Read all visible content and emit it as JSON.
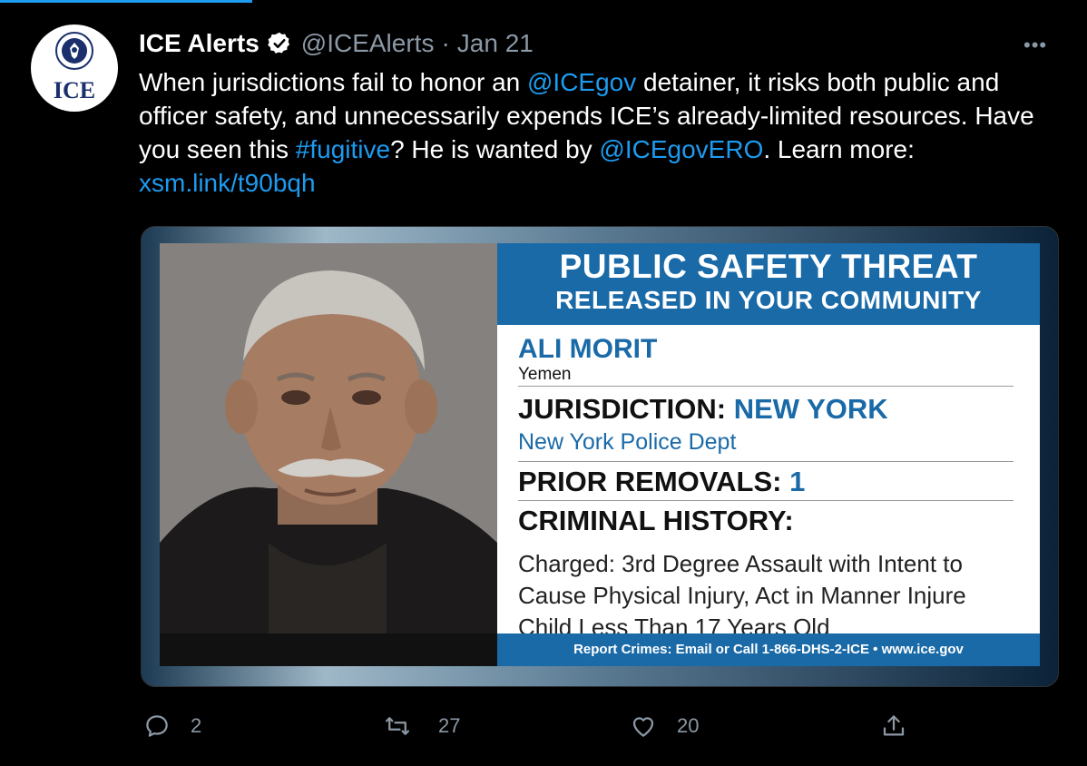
{
  "tweet": {
    "author_name": "ICE Alerts",
    "handle": "@ICEAlerts",
    "separator": "·",
    "date": "Jan 21",
    "more_label": "•••",
    "avatar_text": "ICE",
    "text_parts": {
      "p1": "When jurisdictions fail to honor an ",
      "mention1": "@ICEgov",
      "p2": " detainer, it risks both public and officer safety, and unnecessarily expends ICE’s already-limited resources. Have you seen this ",
      "hashtag": "#fugitive",
      "p3": "? He is wanted by ",
      "mention2": "@ICEgovERO",
      "p4": ". Learn more: ",
      "link": "xsm.link/t90bqh"
    }
  },
  "card": {
    "banner_title": "PUBLIC SAFETY THREAT",
    "banner_subtitle": "RELEASED IN YOUR COMMUNITY",
    "person_name": "ALI MORIT",
    "country": "Yemen",
    "jurisdiction_label": "JURISDICTION:",
    "jurisdiction_value": "NEW YORK",
    "police_dept": "New York Police Dept",
    "prior_removals_label": "PRIOR REMOVALS:",
    "prior_removals_value": "1",
    "criminal_history_label": "CRIMINAL HISTORY:",
    "charges": "Charged: 3rd Degree Assault with Intent to Cause Physical Injury, Act in Manner Injure Child Less Than 17 Years Old",
    "footer": "Report Crimes: Email or Call 1-866-DHS-2-ICE  •  www.ice.gov"
  },
  "actions": {
    "reply_count": "2",
    "retweet_count": "27",
    "like_count": "20"
  },
  "colors": {
    "link": "#1d9bf0",
    "muted": "#8b98a5",
    "card_blue": "#1a6aa8"
  },
  "icons": [
    "verified-badge-icon",
    "more-icon",
    "reply-icon",
    "retweet-icon",
    "like-icon",
    "share-icon"
  ]
}
